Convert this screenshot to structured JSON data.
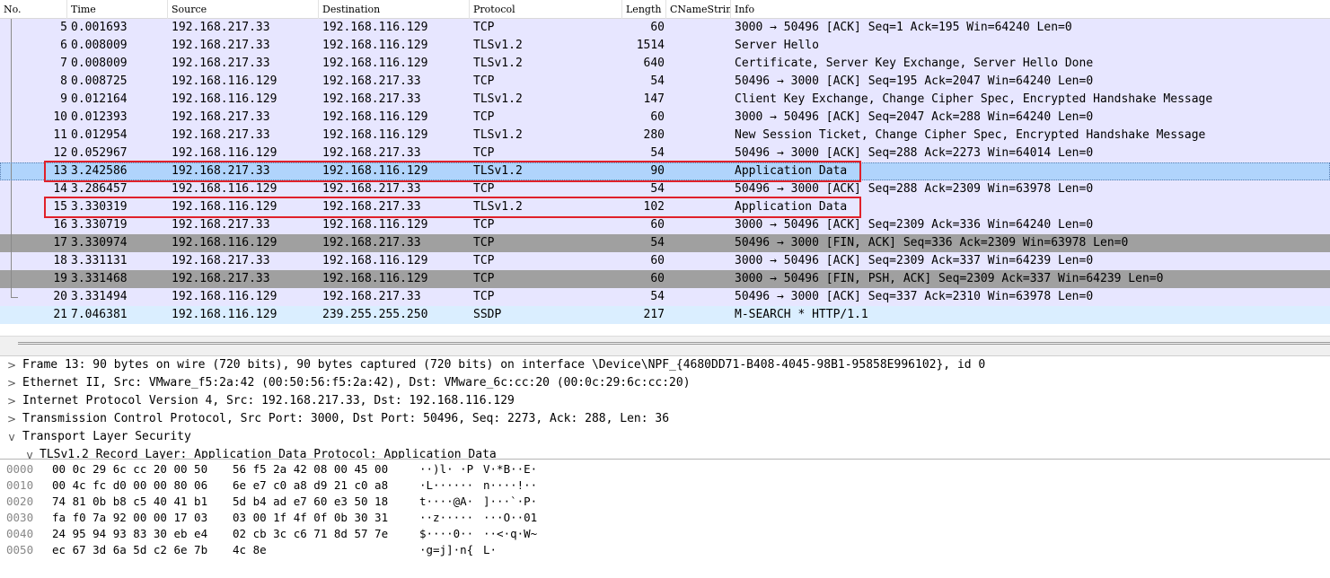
{
  "columns": {
    "no": "No.",
    "time": "Time",
    "source": "Source",
    "destination": "Destination",
    "protocol": "Protocol",
    "length": "Length",
    "cname": "CNameString",
    "info": "Info"
  },
  "packets": [
    {
      "no": "5",
      "time": "0.001693",
      "src": "192.168.217.33",
      "dst": "192.168.116.129",
      "proto": "TCP",
      "len": "60",
      "info": "3000 → 50496 [ACK] Seq=1 Ack=195 Win=64240 Len=0",
      "style": "tcp"
    },
    {
      "no": "6",
      "time": "0.008009",
      "src": "192.168.217.33",
      "dst": "192.168.116.129",
      "proto": "TLSv1.2",
      "len": "1514",
      "info": "Server Hello",
      "style": "tcp"
    },
    {
      "no": "7",
      "time": "0.008009",
      "src": "192.168.217.33",
      "dst": "192.168.116.129",
      "proto": "TLSv1.2",
      "len": "640",
      "info": "Certificate, Server Key Exchange, Server Hello Done",
      "style": "tcp"
    },
    {
      "no": "8",
      "time": "0.008725",
      "src": "192.168.116.129",
      "dst": "192.168.217.33",
      "proto": "TCP",
      "len": "54",
      "info": "50496 → 3000 [ACK] Seq=195 Ack=2047 Win=64240 Len=0",
      "style": "tcp"
    },
    {
      "no": "9",
      "time": "0.012164",
      "src": "192.168.116.129",
      "dst": "192.168.217.33",
      "proto": "TLSv1.2",
      "len": "147",
      "info": "Client Key Exchange, Change Cipher Spec, Encrypted Handshake Message",
      "style": "tcp"
    },
    {
      "no": "10",
      "time": "0.012393",
      "src": "192.168.217.33",
      "dst": "192.168.116.129",
      "proto": "TCP",
      "len": "60",
      "info": "3000 → 50496 [ACK] Seq=2047 Ack=288 Win=64240 Len=0",
      "style": "tcp"
    },
    {
      "no": "11",
      "time": "0.012954",
      "src": "192.168.217.33",
      "dst": "192.168.116.129",
      "proto": "TLSv1.2",
      "len": "280",
      "info": "New Session Ticket, Change Cipher Spec, Encrypted Handshake Message",
      "style": "tcp"
    },
    {
      "no": "12",
      "time": "0.052967",
      "src": "192.168.116.129",
      "dst": "192.168.217.33",
      "proto": "TCP",
      "len": "54",
      "info": "50496 → 3000 [ACK] Seq=288 Ack=2273 Win=64014 Len=0",
      "style": "tcp"
    },
    {
      "no": "13",
      "time": "3.242586",
      "src": "192.168.217.33",
      "dst": "192.168.116.129",
      "proto": "TLSv1.2",
      "len": "90",
      "info": "Application Data",
      "style": "sel"
    },
    {
      "no": "14",
      "time": "3.286457",
      "src": "192.168.116.129",
      "dst": "192.168.217.33",
      "proto": "TCP",
      "len": "54",
      "info": "50496 → 3000 [ACK] Seq=288 Ack=2309 Win=63978 Len=0",
      "style": "tcp"
    },
    {
      "no": "15",
      "time": "3.330319",
      "src": "192.168.116.129",
      "dst": "192.168.217.33",
      "proto": "TLSv1.2",
      "len": "102",
      "info": "Application Data",
      "style": "tcp"
    },
    {
      "no": "16",
      "time": "3.330719",
      "src": "192.168.217.33",
      "dst": "192.168.116.129",
      "proto": "TCP",
      "len": "60",
      "info": "3000 → 50496 [ACK] Seq=2309 Ack=336 Win=64240 Len=0",
      "style": "tcp"
    },
    {
      "no": "17",
      "time": "3.330974",
      "src": "192.168.116.129",
      "dst": "192.168.217.33",
      "proto": "TCP",
      "len": "54",
      "info": "50496 → 3000 [FIN, ACK] Seq=336 Ack=2309 Win=63978 Len=0",
      "style": "dark"
    },
    {
      "no": "18",
      "time": "3.331131",
      "src": "192.168.217.33",
      "dst": "192.168.116.129",
      "proto": "TCP",
      "len": "60",
      "info": "3000 → 50496 [ACK] Seq=2309 Ack=337 Win=64239 Len=0",
      "style": "tcp"
    },
    {
      "no": "19",
      "time": "3.331468",
      "src": "192.168.217.33",
      "dst": "192.168.116.129",
      "proto": "TCP",
      "len": "60",
      "info": "3000 → 50496 [FIN, PSH, ACK] Seq=2309 Ack=337 Win=64239 Len=0",
      "style": "dark"
    },
    {
      "no": "20",
      "time": "3.331494",
      "src": "192.168.116.129",
      "dst": "192.168.217.33",
      "proto": "TCP",
      "len": "54",
      "info": "50496 → 3000 [ACK] Seq=337 Ack=2310 Win=63978 Len=0",
      "style": "tcp"
    },
    {
      "no": "21",
      "time": "7.046381",
      "src": "192.168.116.129",
      "dst": "239.255.255.250",
      "proto": "SSDP",
      "len": "217",
      "info": "M-SEARCH * HTTP/1.1",
      "style": "udp"
    }
  ],
  "details": [
    {
      "twisty": ">",
      "text": "Frame 13: 90 bytes on wire (720 bits), 90 bytes captured (720 bits) on interface \\Device\\NPF_{4680DD71-B408-4045-98B1-95858E996102}, id 0"
    },
    {
      "twisty": ">",
      "text": "Ethernet II, Src: VMware_f5:2a:42 (00:50:56:f5:2a:42), Dst: VMware_6c:cc:20 (00:0c:29:6c:cc:20)"
    },
    {
      "twisty": ">",
      "text": "Internet Protocol Version 4, Src: 192.168.217.33, Dst: 192.168.116.129"
    },
    {
      "twisty": ">",
      "text": "Transmission Control Protocol, Src Port: 3000, Dst Port: 50496, Seq: 2273, Ack: 288, Len: 36"
    },
    {
      "twisty": "v",
      "text": "Transport Layer Security"
    },
    {
      "twisty": "v",
      "text": "TLSv1.2 Record Layer: Application Data Protocol: Application Data"
    }
  ],
  "bytes": [
    {
      "offset": "0000",
      "hex1": "00 0c 29 6c cc 20 00 50",
      "hex2": "56 f5 2a 42 08 00 45 00",
      "ascii1": "··)l· ·P",
      "ascii2": "V·*B··E·"
    },
    {
      "offset": "0010",
      "hex1": "00 4c fc d0 00 00 80 06",
      "hex2": "6e e7 c0 a8 d9 21 c0 a8",
      "ascii1": "·L······",
      "ascii2": "n····!··"
    },
    {
      "offset": "0020",
      "hex1": "74 81 0b b8 c5 40 41 b1",
      "hex2": "5d b4 ad e7 60 e3 50 18",
      "ascii1": "t····@A·",
      "ascii2": "]···`·P·"
    },
    {
      "offset": "0030",
      "hex1": "fa f0 7a 92 00 00 17 03",
      "hex2": "03 00 1f 4f 0f 0b 30 31",
      "ascii1": "··z·····",
      "ascii2": "···O··01"
    },
    {
      "offset": "0040",
      "hex1": "24 95 94 93 83 30 eb e4",
      "hex2": "02 cb 3c c6 71 8d 57 7e",
      "ascii1": "$····0··",
      "ascii2": "··<·q·W~"
    },
    {
      "offset": "0050",
      "hex1": "ec 67 3d 6a 5d c2 6e 7b",
      "hex2": "4c 8e",
      "ascii1": "·g=j]·n{",
      "ascii2": "L·"
    }
  ]
}
